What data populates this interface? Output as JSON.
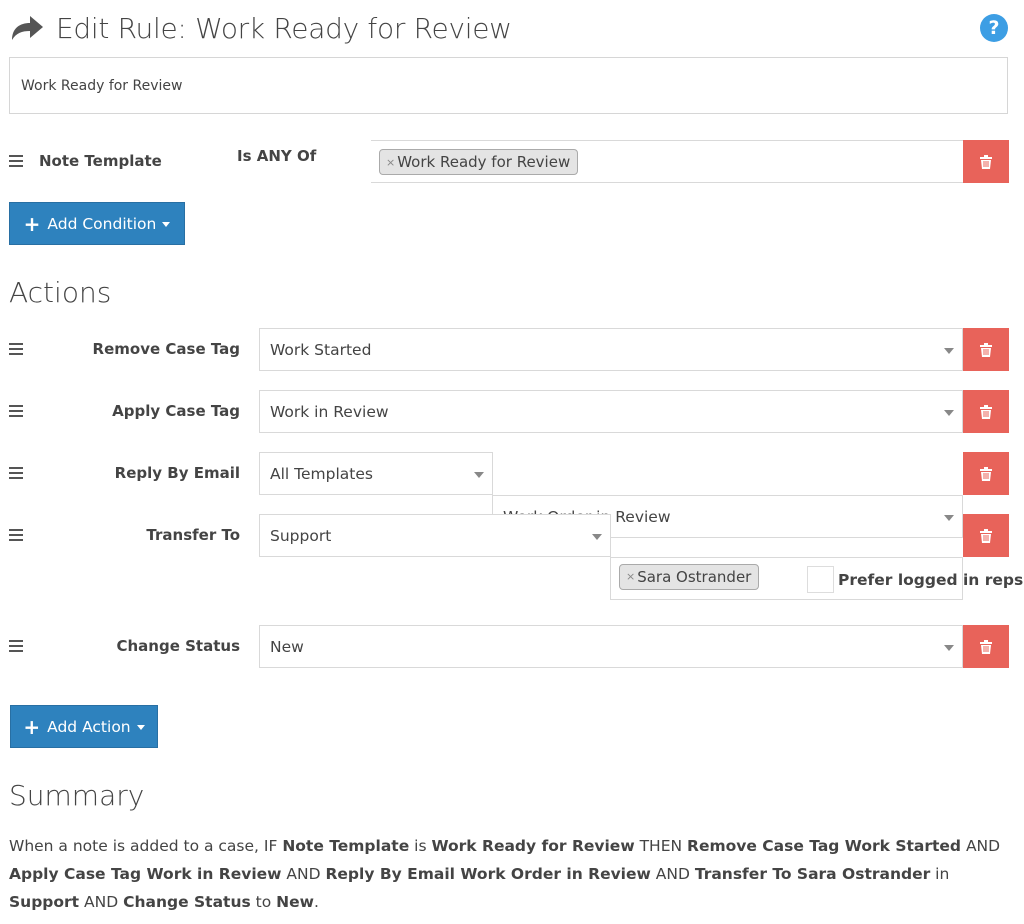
{
  "header": {
    "title": "Edit Rule: Work Ready for Review",
    "icon": "share-arrow-icon",
    "help_icon_glyph": "?"
  },
  "rule_name": {
    "value": "Work Ready for Review",
    "placeholder": ""
  },
  "conditions": [
    {
      "field": "Note Template",
      "operator": "Is ANY Of",
      "values": [
        "Work Ready for Review"
      ],
      "chip_remove_glyph": "×"
    }
  ],
  "add_condition_button": {
    "icon": "plus-icon",
    "label": "Add Condition"
  },
  "actions_heading": "Actions",
  "actions": [
    {
      "label": "Remove Case Tag",
      "selects": [
        "Work Started"
      ]
    },
    {
      "label": "Apply Case Tag",
      "selects": [
        "Work in Review"
      ]
    },
    {
      "label": "Reply By Email",
      "selects": [
        "All Templates",
        "Work Order in Review"
      ]
    },
    {
      "label": "Transfer To",
      "selects": [
        "Support"
      ],
      "chips": [
        "Sara Ostrander"
      ],
      "checkbox": {
        "label": "Prefer logged in reps",
        "checked": false
      }
    },
    {
      "label": "Change Status",
      "selects": [
        "New"
      ]
    }
  ],
  "add_action_button": {
    "icon": "plus-icon",
    "label": "Add Action"
  },
  "summary_heading": "Summary",
  "summary": {
    "segments": [
      {
        "t": "When a note is added to a case, IF ",
        "b": false
      },
      {
        "t": "Note Template",
        "b": true
      },
      {
        "t": " is ",
        "b": false
      },
      {
        "t": "Work Ready for Review",
        "b": true
      },
      {
        "t": " THEN ",
        "b": false
      },
      {
        "t": "Remove Case Tag Work Started",
        "b": true
      },
      {
        "t": " AND ",
        "b": false
      },
      {
        "t": "Apply Case Tag Work in Review",
        "b": true
      },
      {
        "t": " AND ",
        "b": false
      },
      {
        "t": "Reply By Email Work Order in Review",
        "b": true
      },
      {
        "t": " AND ",
        "b": false
      },
      {
        "t": "Transfer To Sara Ostrander",
        "b": true
      },
      {
        "t": " in ",
        "b": false
      },
      {
        "t": "Support",
        "b": true
      },
      {
        "t": " AND ",
        "b": false
      },
      {
        "t": "Change Status",
        "b": true
      },
      {
        "t": " to ",
        "b": false
      },
      {
        "t": "New",
        "b": true
      },
      {
        "t": ".",
        "b": false
      }
    ]
  },
  "colors": {
    "primary": "#2e82be",
    "danger": "#e8635a",
    "help": "#3d9ee4",
    "text": "#444444"
  }
}
